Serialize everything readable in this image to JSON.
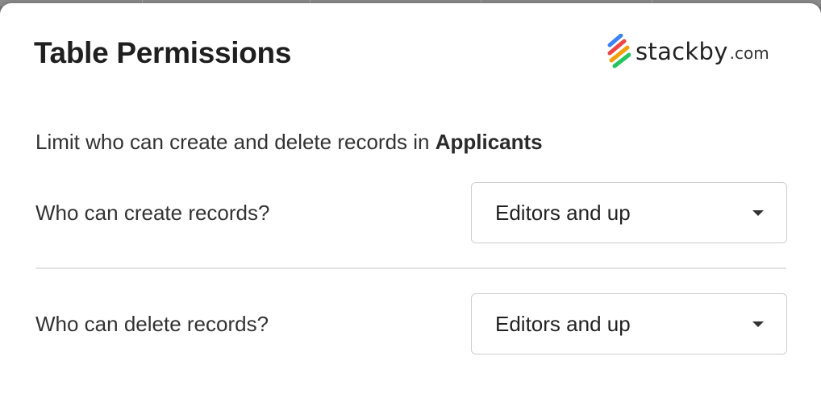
{
  "dialog": {
    "title": "Table Permissions",
    "brand": {
      "name": "stackby",
      "tld": ".com",
      "stripe_colors": [
        "#3b82f6",
        "#ef4444",
        "#f59e0b",
        "#22c55e"
      ]
    },
    "description": {
      "prefix": "Limit who can create and delete records in ",
      "table_name": "Applicants"
    },
    "permissions": [
      {
        "label": "Who can create records?",
        "value": "Editors and up"
      },
      {
        "label": "Who can delete records?",
        "value": "Editors and up"
      }
    ]
  }
}
